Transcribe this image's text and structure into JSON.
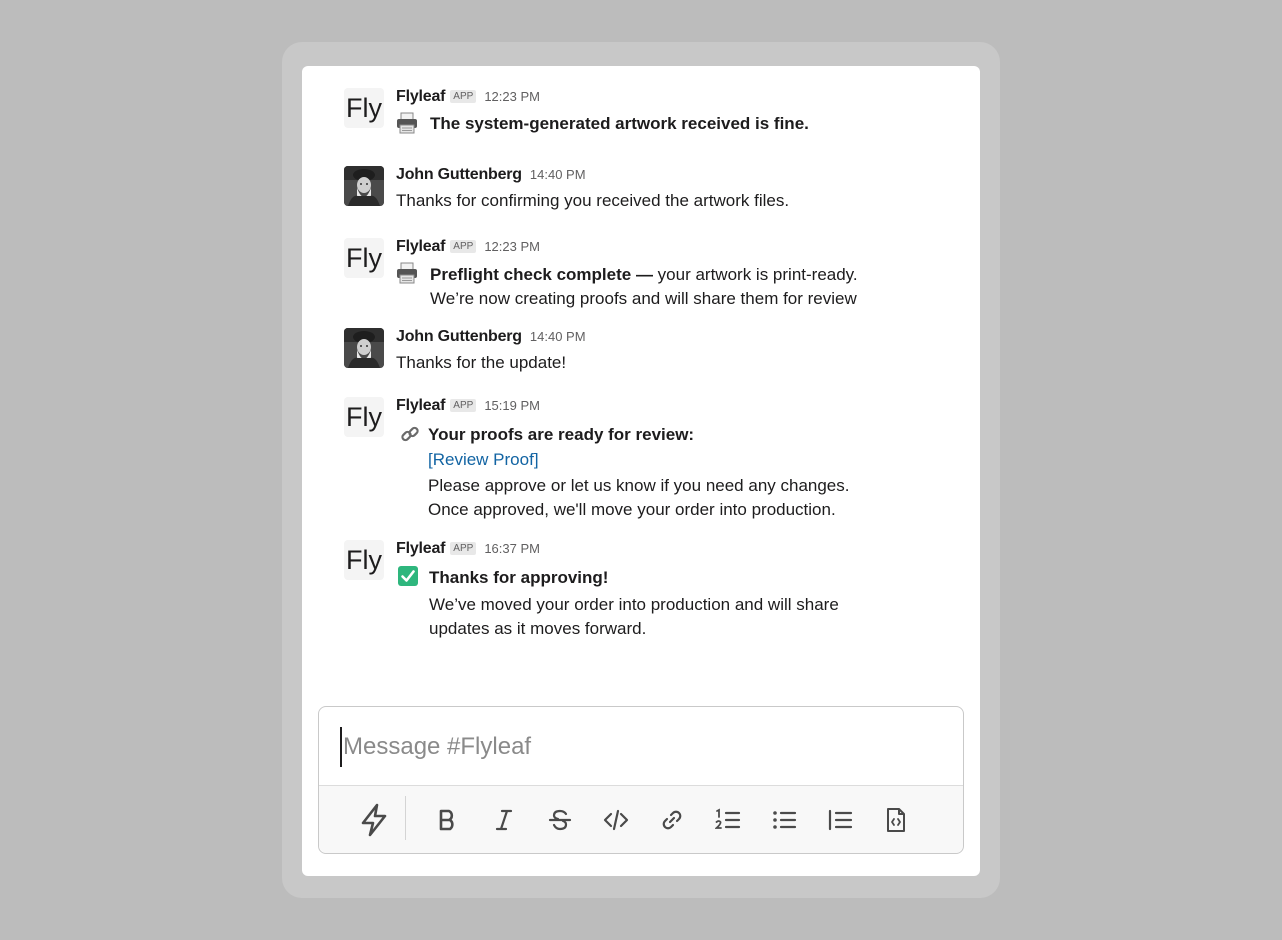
{
  "channel": {
    "placeholder": "Message #Flyleaf"
  },
  "messages": [
    {
      "sender": "Flyleaf",
      "badge": "APP",
      "time": "12:23 PM",
      "avatar_text": "Fly",
      "icon": "printer-icon",
      "lines": [
        "The system-generated artwork received is fine."
      ]
    },
    {
      "sender": "John Guttenberg",
      "time": "14:40 PM",
      "lines": [
        "Thanks for confirming you received the artwork files."
      ]
    },
    {
      "sender": "Flyleaf",
      "badge": "APP",
      "time": "12:23 PM",
      "avatar_text": "Fly",
      "icon": "printer-icon",
      "bold": "Preflight check complete —",
      "lines": [
        " your artwork is print-ready.",
        "We’re now creating proofs and will share them for review"
      ]
    },
    {
      "sender": "John Guttenberg",
      "time": "14:40 PM",
      "lines": [
        "Thanks for the update!"
      ]
    },
    {
      "sender": "Flyleaf",
      "badge": "APP",
      "time": "15:19 PM",
      "avatar_text": "Fly",
      "icon": "link-icon",
      "lines": [
        "Your proofs are ready for review:",
        "[Review Proof]",
        "Please approve or let us know if you need any changes.",
        "Once approved, we'll move your order into production."
      ]
    },
    {
      "sender": "Flyleaf",
      "badge": "APP",
      "time": "16:37 PM",
      "avatar_text": "Fly",
      "icon": "check-mark-icon",
      "lines": [
        "Thanks for approving!",
        "We’ve moved your order into production and will share",
        "updates as it moves forward."
      ]
    }
  ],
  "toolbar": {
    "tools": [
      "shortcuts-icon",
      "bold-icon",
      "italic-icon",
      "strikethrough-icon",
      "code-icon",
      "link-icon",
      "ordered-list-icon",
      "bulleted-list-icon",
      "blockquote-icon",
      "code-block-icon"
    ]
  },
  "colors": {
    "link": "#1264a3",
    "background": "#bcbcbc",
    "check": "#2eb67d"
  }
}
